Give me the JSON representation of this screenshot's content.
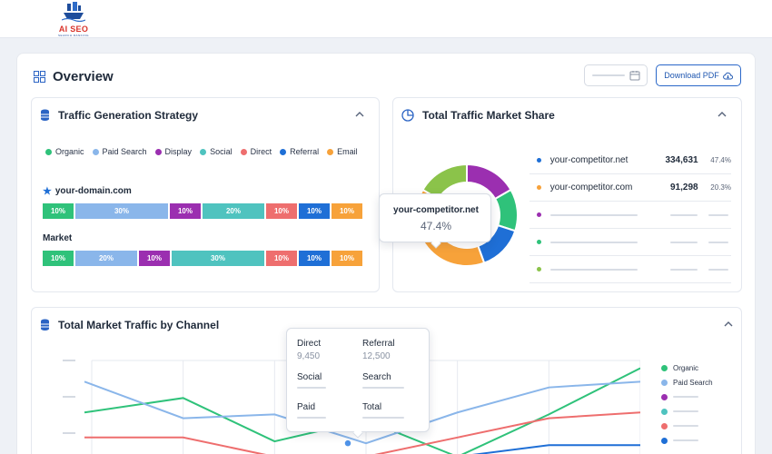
{
  "brand": {
    "name": "AI SEO",
    "tagline": "SEARCH RANKING"
  },
  "overview": {
    "title": "Overview",
    "download_label": "Download PDF"
  },
  "traffic_strategy": {
    "title": "Traffic Generation Strategy",
    "legend": [
      {
        "label": "Organic",
        "color": "#2fc27a"
      },
      {
        "label": "Paid Search",
        "color": "#8ab6ea"
      },
      {
        "label": "Display",
        "color": "#9b2fb0"
      },
      {
        "label": "Social",
        "color": "#4fc3bf"
      },
      {
        "label": "Direct",
        "color": "#ee6e6e"
      },
      {
        "label": "Referral",
        "color": "#1f6fd6"
      },
      {
        "label": "Email",
        "color": "#f7a23a"
      }
    ],
    "rows": [
      {
        "label": "your-domain.com",
        "segments": [
          "10%",
          "30%",
          "10%",
          "20%",
          "10%",
          "10%",
          "10%"
        ]
      },
      {
        "label": "Market",
        "segments": [
          "10%",
          "20%",
          "10%",
          "30%",
          "10%",
          "10%",
          "10%"
        ]
      }
    ]
  },
  "market_share": {
    "title": "Total Traffic Market Share",
    "tooltip": {
      "name": "your-competitor.net",
      "value": "47.4%"
    },
    "rows": [
      {
        "name": "your-competitor.net",
        "value": "334,631",
        "pct": "47.4%",
        "color": "#1f6fd6"
      },
      {
        "name": "your-competitor.com",
        "value": "91,298",
        "pct": "20.3%",
        "color": "#f7a23a"
      },
      {
        "color": "#9b2fb0"
      },
      {
        "color": "#2fc27a"
      },
      {
        "color": "#8bc34a"
      }
    ]
  },
  "channel_traffic": {
    "title": "Total Market Traffic by Channel",
    "tooltip": {
      "direct_label": "Direct",
      "direct_value": "9,450",
      "referral_label": "Referral",
      "referral_value": "12,500",
      "social_label": "Social",
      "search_label": "Search",
      "paid_label": "Paid",
      "total_label": "Total"
    },
    "legend": [
      {
        "label": "Organic",
        "color": "#2fc27a"
      },
      {
        "label": "Paid Search",
        "color": "#8ab6ea"
      },
      {
        "label": "",
        "color": "#9b2fb0"
      },
      {
        "label": "",
        "color": "#4fc3bf"
      },
      {
        "label": "",
        "color": "#ee6e6e"
      },
      {
        "label": "",
        "color": "#1f6fd6"
      }
    ]
  },
  "chart_data": [
    {
      "type": "pie",
      "title": "Total Traffic Market Share",
      "categories": [
        "Purple segment",
        "Green segment",
        "Blue segment",
        "Orange segment",
        "Lime segment"
      ],
      "values": [
        15,
        12,
        13,
        35,
        15
      ],
      "colors": [
        "#9b2fb0",
        "#2fc27a",
        "#1f6fd6",
        "#f7a23a",
        "#8bc34a"
      ]
    },
    {
      "type": "line",
      "title": "Total Market Traffic by Channel",
      "x": [
        0,
        1,
        2,
        3,
        4,
        5,
        6
      ],
      "ylim": [
        0,
        100
      ],
      "series": [
        {
          "name": "Organic",
          "color": "#2fc27a",
          "values": [
            46,
            61,
            16,
            38,
            0,
            44,
            92
          ]
        },
        {
          "name": "Paid Search",
          "color": "#8ab6ea",
          "values": [
            78,
            40,
            44,
            14,
            46,
            72,
            78
          ]
        },
        {
          "name": "",
          "color": "#ee6e6e",
          "values": [
            20,
            20,
            0,
            0,
            20,
            40,
            46
          ]
        },
        {
          "name": "",
          "color": "#1f6fd6",
          "values": [
            0,
            0,
            0,
            0,
            0,
            12,
            12
          ]
        }
      ]
    }
  ]
}
